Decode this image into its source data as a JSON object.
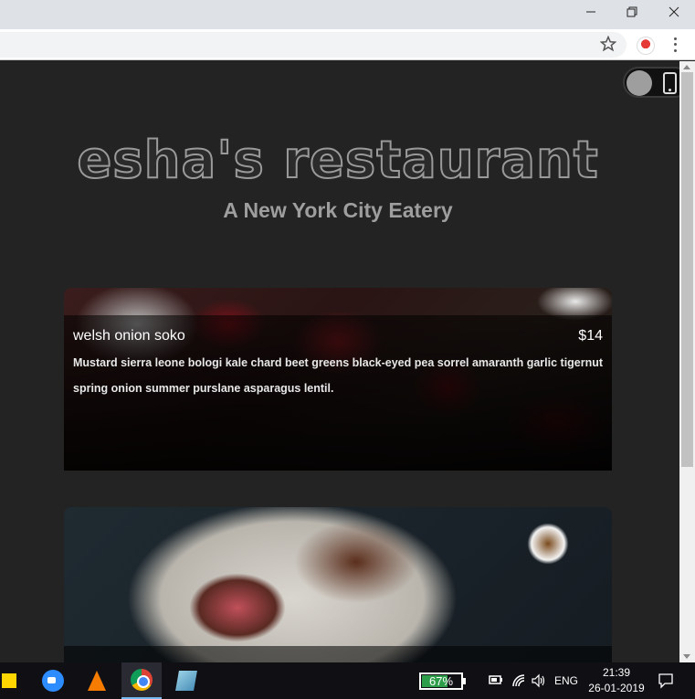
{
  "browser": {
    "window_controls": {
      "minimize": "−",
      "maximize": "❐",
      "close": "✕"
    }
  },
  "page": {
    "brand": "esha's restaurant",
    "tagline": "A New York City Eatery",
    "menu_items": [
      {
        "name": "welsh onion soko",
        "price": "$14",
        "description": "Mustard sierra leone bologi kale chard beet greens black-eyed pea sorrel amaranth garlic tigernut spring onion summer purslane asparagus lentil."
      },
      {
        "name": "",
        "price": ""
      }
    ]
  },
  "taskbar": {
    "battery_percent": "67%",
    "battery_level": 0.67,
    "language": "ENG",
    "time": "21:39",
    "date": "26-01-2019",
    "apps": [
      "sticky-notes-icon",
      "zoom-icon",
      "vlc-icon",
      "chrome-icon",
      "app-icon"
    ]
  },
  "colors": {
    "page_bg": "#232323",
    "brand_stroke": "#9a9a9a",
    "tagline": "#9e9e9e",
    "battery_green": "#2e9e4a"
  }
}
